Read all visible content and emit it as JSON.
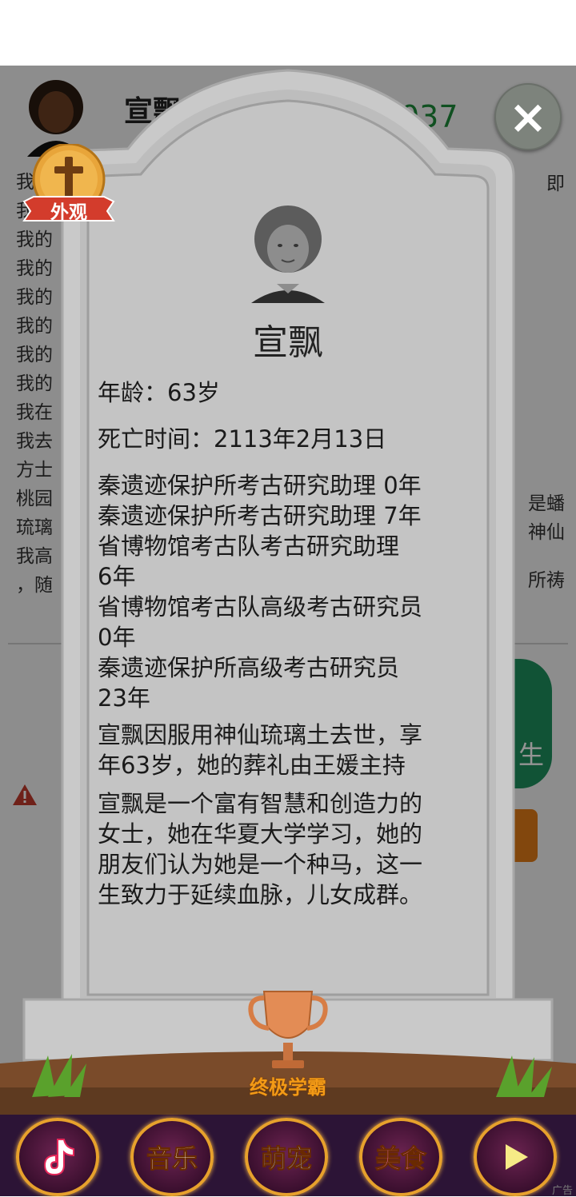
{
  "background": {
    "player_name": "宣飘",
    "score_fragment": "037",
    "lines": [
      "我",
      "我的",
      "我的",
      "我的",
      "我的",
      "我的",
      "我的",
      "我的",
      "我在",
      "我去",
      "方士",
      "桃园",
      "琉璃",
      "我高",
      "，随"
    ],
    "right_fragments": [
      "即",
      "是蟠",
      "神仙",
      "所祷"
    ],
    "green_button_label": "生"
  },
  "tombstone": {
    "name": "宣飘",
    "age": "年龄：63岁",
    "death_time": "死亡时间：2113年2月13日",
    "career": [
      "秦遗迹保护所考古研究助理 0年",
      "秦遗迹保护所考古研究助理 7年",
      "省博物馆考古队考古研究助理",
      "6年",
      "省博物馆考古队高级考古研究员",
      "0年",
      "秦遗迹保护所高级考古研究员",
      "23年"
    ],
    "death_cause": [
      "宣飘因服用神仙琉璃土去世，享",
      "年63岁，她的葬礼由王媛主持"
    ],
    "bio": [
      "宣飘是一个富有智慧和创造力的",
      "女士，她在华夏大学学习，她的",
      "朋友们认为她是一个种马，这一",
      "生致力于延续血脉，儿女成群。"
    ],
    "badge_label": "外观",
    "trophy_label": "终极学霸",
    "close_icon": "×"
  },
  "dock": {
    "items": [
      {
        "label": "",
        "icon": "tiktok-icon"
      },
      {
        "label": "音乐"
      },
      {
        "label": "萌宠"
      },
      {
        "label": "美食"
      },
      {
        "label": "",
        "icon": "play-icon"
      }
    ],
    "ad_label": "广告"
  }
}
